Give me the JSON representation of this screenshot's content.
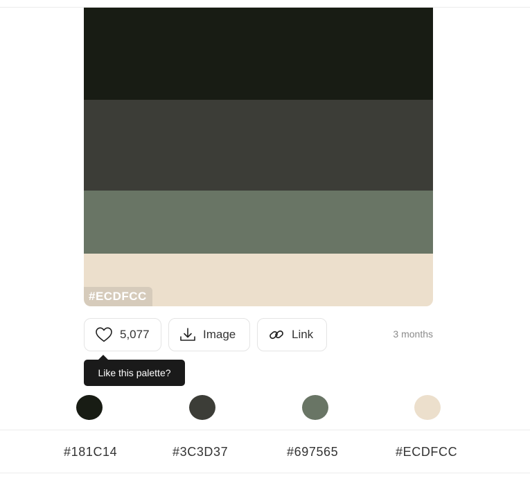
{
  "palette": {
    "colors": [
      {
        "hex": "#181C14",
        "label": "#181C14"
      },
      {
        "hex": "#3C3D37",
        "label": "#3C3D37"
      },
      {
        "hex": "#697565",
        "label": "#697565"
      },
      {
        "hex": "#ECDFCC",
        "label": "#ECDFCC"
      }
    ],
    "hovered_label": "#ECDFCC"
  },
  "actions": {
    "like_count": "5,077",
    "image_label": "Image",
    "link_label": "Link",
    "age": "3 months"
  },
  "tooltip": {
    "text": "Like this palette?"
  },
  "icons": {
    "like": "heart-icon",
    "image": "download-icon",
    "link": "link-icon"
  }
}
